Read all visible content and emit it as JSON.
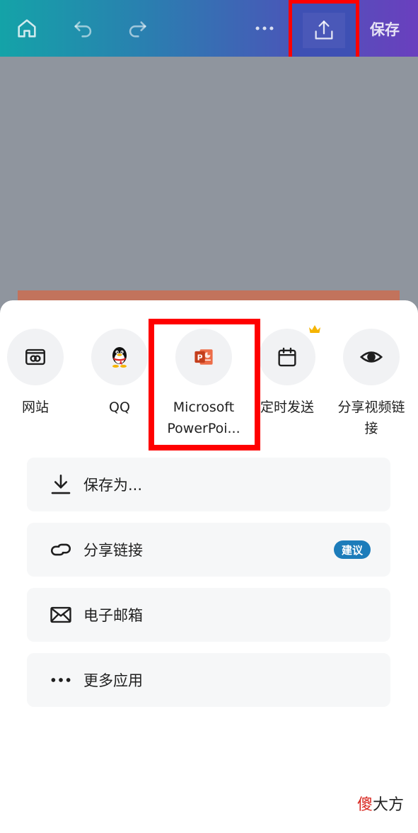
{
  "topbar": {
    "save_label": "保存",
    "icons": [
      "home-icon",
      "undo-icon",
      "redo-icon",
      "more-icon",
      "share-icon"
    ],
    "gradient_colors": [
      "#14a3a8",
      "#6a3fbe"
    ]
  },
  "share_sheet": {
    "apps": [
      {
        "label": "网站",
        "icon": "website-icon"
      },
      {
        "label": "QQ",
        "icon": "qq-penguin-icon"
      },
      {
        "label": "Microsoft PowerPoi...",
        "line1": "Microsoft",
        "line2": "PowerPoi...",
        "icon": "powerpoint-icon"
      },
      {
        "label": "定时发送",
        "icon": "calendar-icon",
        "premium": true
      },
      {
        "label": "分享视频链接",
        "line1": "分享视频链",
        "line2": "接",
        "icon": "eye-icon"
      }
    ],
    "options": [
      {
        "label": "保存为...",
        "icon": "download-icon"
      },
      {
        "label": "分享链接",
        "icon": "link-icon",
        "badge": "建议"
      },
      {
        "label": "电子邮箱",
        "icon": "mail-icon"
      },
      {
        "label": "更多应用",
        "icon": "more-horizontal-icon"
      }
    ]
  },
  "highlight_color": "#ff0000",
  "badge_color": "#1c7cba",
  "watermark": {
    "red": "傻",
    "rest": "大方"
  }
}
